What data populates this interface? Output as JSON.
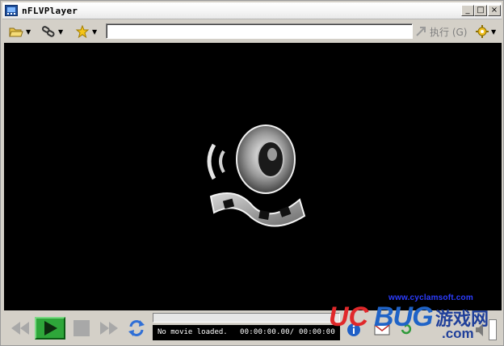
{
  "window": {
    "title": "nFLVPlayer",
    "minimize_label": "_",
    "maximize_label": "□",
    "close_label": "×"
  },
  "toolbar": {
    "open_icon": "folder-open-icon",
    "link_icon": "link-icon",
    "favorites_icon": "star-icon",
    "url_value": "",
    "execute_label": "执行 (G)",
    "execute_icon": "arrow-icon",
    "settings_icon": "gear-icon"
  },
  "video": {
    "placeholder_icon": "speaker-film-icon",
    "watermark": "www.cyclamsoft.com"
  },
  "controls": {
    "status_message": "No movie loaded.",
    "time_text": "00:00:00.00/ 00:00:00",
    "progress": 0
  },
  "logo": {
    "uc": "UC",
    "bug": "BUG",
    "cn": "游戏网",
    "com": ".com"
  },
  "colors": {
    "chrome": "#d4d0c8",
    "video_bg": "#000000",
    "play_green": "#1f9a2a",
    "logo_red": "#e0282a",
    "logo_blue": "#1f63c7"
  }
}
